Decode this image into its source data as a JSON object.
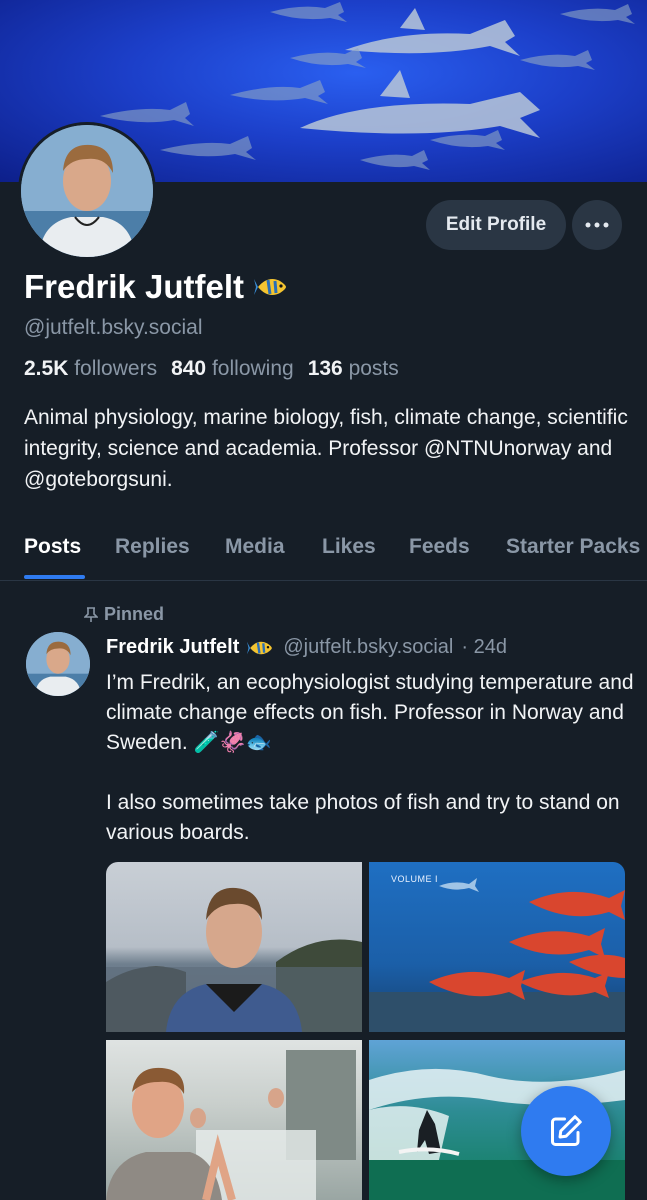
{
  "profile": {
    "display_name": "Fredrik Jutfelt",
    "name_emoji": "tropical-fish-emoji",
    "handle": "@jutfelt.bsky.social",
    "followers_count": "2.5K",
    "followers_label": "followers",
    "following_count": "840",
    "following_label": "following",
    "posts_count": "136",
    "posts_label": "posts",
    "bio": "Animal physiology, marine biology, fish, climate change, scientific integrity, science and academia. Professor @NTNUnorway and @goteborgsuni."
  },
  "actions": {
    "edit_profile": "Edit Profile",
    "more_icon": "ellipsis-icon"
  },
  "tabs": [
    {
      "label": "Posts",
      "active": true
    },
    {
      "label": "Replies",
      "active": false
    },
    {
      "label": "Media",
      "active": false
    },
    {
      "label": "Likes",
      "active": false
    },
    {
      "label": "Feeds",
      "active": false
    },
    {
      "label": "Starter Packs",
      "active": false
    }
  ],
  "pinned_post": {
    "pinned_label": "Pinned",
    "author_name": "Fredrik Jutfelt",
    "author_handle": "@jutfelt.bsky.social",
    "age": "· 24d",
    "text": "I’m Fredrik, an ecophysiologist studying temperature and climate change effects on fish. Professor in Norway and Sweden. 🧪🦑🐟\n\nI also sometimes take photos of fish and try to stand on various boards.",
    "image_caption_text": "VOLUME I"
  },
  "fab": {
    "icon": "compose-icon"
  },
  "colors": {
    "background": "#161e27",
    "accent": "#2f7bf0",
    "muted_text": "#8a97a6",
    "button_bg": "#2a3644"
  }
}
